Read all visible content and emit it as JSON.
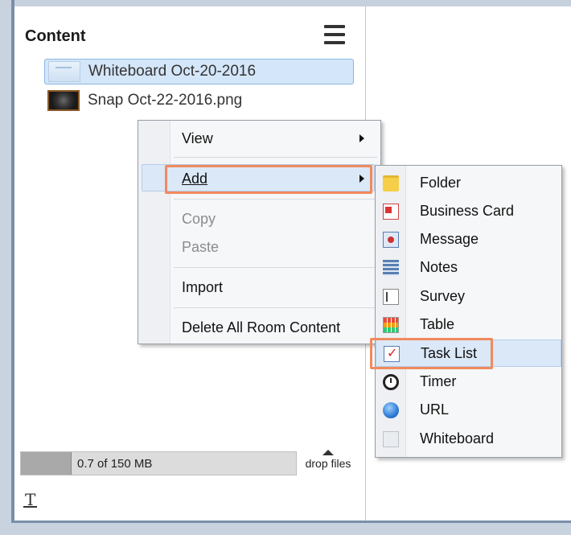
{
  "panel": {
    "title": "Content"
  },
  "content_items": [
    {
      "label": "Whiteboard Oct-20-2016",
      "selected": true
    },
    {
      "label": "Snap Oct-22-2016.png",
      "selected": false
    }
  ],
  "storage": {
    "usage_text": "0.7 of 150 MB",
    "used_mb": 0.7,
    "total_mb": 150
  },
  "drop_files_label": "drop files",
  "text_tool_glyph": "T",
  "context_menu": {
    "items": [
      {
        "label": "View",
        "has_submenu": true,
        "enabled": true
      },
      {
        "label": "Add",
        "has_submenu": true,
        "enabled": true,
        "active": true
      },
      {
        "label": "Copy",
        "enabled": false
      },
      {
        "label": "Paste",
        "enabled": false
      },
      {
        "label": "Import",
        "enabled": true
      },
      {
        "label": "Delete All Room Content",
        "enabled": true
      }
    ]
  },
  "add_submenu": {
    "items": [
      {
        "label": "Folder",
        "icon": "folder-icon"
      },
      {
        "label": "Business Card",
        "icon": "business-card-icon"
      },
      {
        "label": "Message",
        "icon": "message-icon"
      },
      {
        "label": "Notes",
        "icon": "notes-icon"
      },
      {
        "label": "Survey",
        "icon": "survey-icon"
      },
      {
        "label": "Table",
        "icon": "table-icon"
      },
      {
        "label": "Task List",
        "icon": "task-list-icon",
        "highlighted": true
      },
      {
        "label": "Timer",
        "icon": "timer-icon"
      },
      {
        "label": "URL",
        "icon": "url-icon"
      },
      {
        "label": "Whiteboard",
        "icon": "whiteboard-icon"
      }
    ]
  },
  "colors": {
    "highlight_outline": "#f08a5d",
    "selection_fill": "#d4e6f9",
    "menu_background": "#f6f7f9"
  }
}
